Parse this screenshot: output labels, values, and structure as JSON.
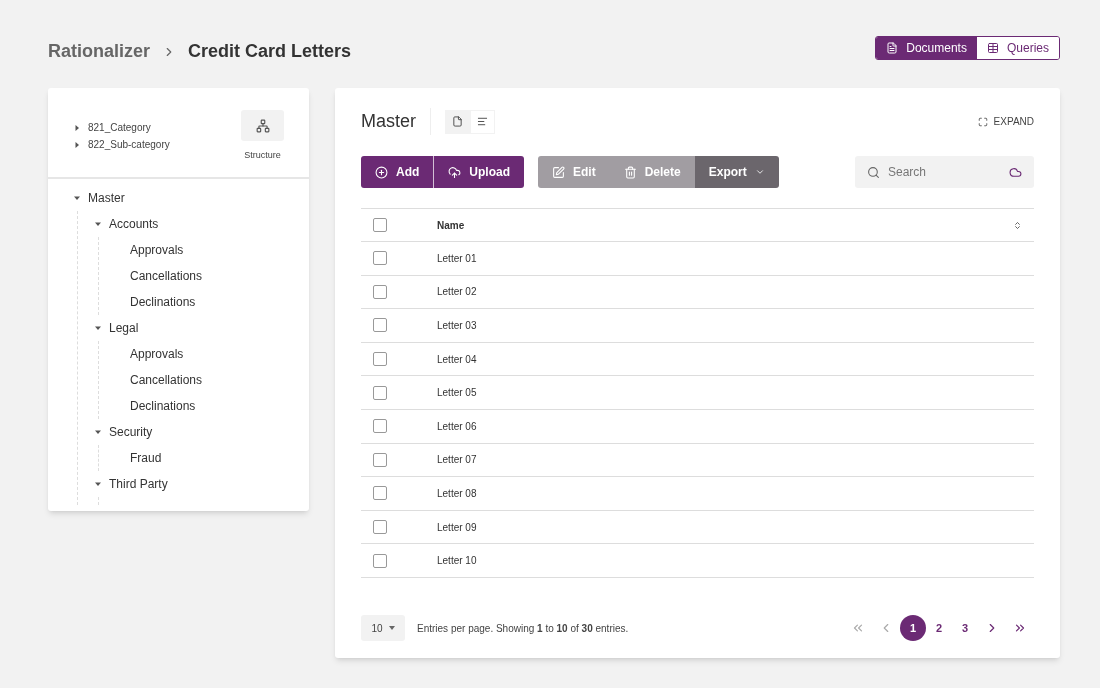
{
  "breadcrumb": [
    "Rationalizer",
    "Credit Card Letters"
  ],
  "view_switch": [
    {
      "label": "Documents",
      "selected": true
    },
    {
      "label": "Queries",
      "selected": false
    }
  ],
  "sidebar": {
    "categories": [
      {
        "label": "821_Category",
        "expanded": false
      },
      {
        "label": "822_Sub-category",
        "expanded": false
      }
    ],
    "structure_button": "Structure",
    "tree": [
      {
        "label": "Master",
        "expanded": true,
        "children": [
          {
            "label": "Accounts",
            "expanded": true,
            "children": [
              {
                "label": "Approvals"
              },
              {
                "label": "Cancellations"
              },
              {
                "label": "Declinations"
              }
            ]
          },
          {
            "label": "Legal",
            "expanded": true,
            "children": [
              {
                "label": "Approvals"
              },
              {
                "label": "Cancellations"
              },
              {
                "label": "Declinations"
              }
            ]
          },
          {
            "label": "Security",
            "expanded": true,
            "children": [
              {
                "label": "Fraud"
              }
            ]
          },
          {
            "label": "Third Party",
            "expanded": true
          }
        ]
      }
    ]
  },
  "main": {
    "title": "Master",
    "layout_toggle": [
      {
        "selected": true
      },
      {
        "selected": false
      }
    ],
    "expand": "EXPAND",
    "actions": [
      {
        "label": "Add",
        "kind": "primary"
      },
      {
        "label": "Upload",
        "kind": "primary"
      },
      {
        "label": "Edit",
        "kind": "muted"
      },
      {
        "label": "Delete",
        "kind": "muted"
      },
      {
        "label": "Export",
        "kind": "dark"
      }
    ],
    "search": {
      "placeholder": "Search"
    },
    "table": {
      "columns": [
        "Name"
      ],
      "header_checked": false,
      "rows": [
        {
          "name": "Letter 01",
          "checked": false
        },
        {
          "name": "Letter 02",
          "checked": false
        },
        {
          "name": "Letter 03",
          "checked": false
        },
        {
          "name": "Letter 04",
          "checked": false
        },
        {
          "name": "Letter 05",
          "checked": false
        },
        {
          "name": "Letter 06",
          "checked": false
        },
        {
          "name": "Letter 07",
          "checked": false
        },
        {
          "name": "Letter 08",
          "checked": false
        },
        {
          "name": "Letter 09",
          "checked": false
        },
        {
          "name": "Letter 10",
          "checked": false
        }
      ]
    },
    "per_page": "10",
    "summary": "Entries per page. Showing **1** to **10** of **30** entries.",
    "pagination": {
      "first_disabled": true,
      "prev_disabled": true,
      "next_disabled": false,
      "last_disabled": false,
      "pages": [
        {
          "label": "1",
          "selected": true
        },
        {
          "label": "2",
          "selected": false
        },
        {
          "label": "3",
          "selected": false
        }
      ]
    }
  }
}
